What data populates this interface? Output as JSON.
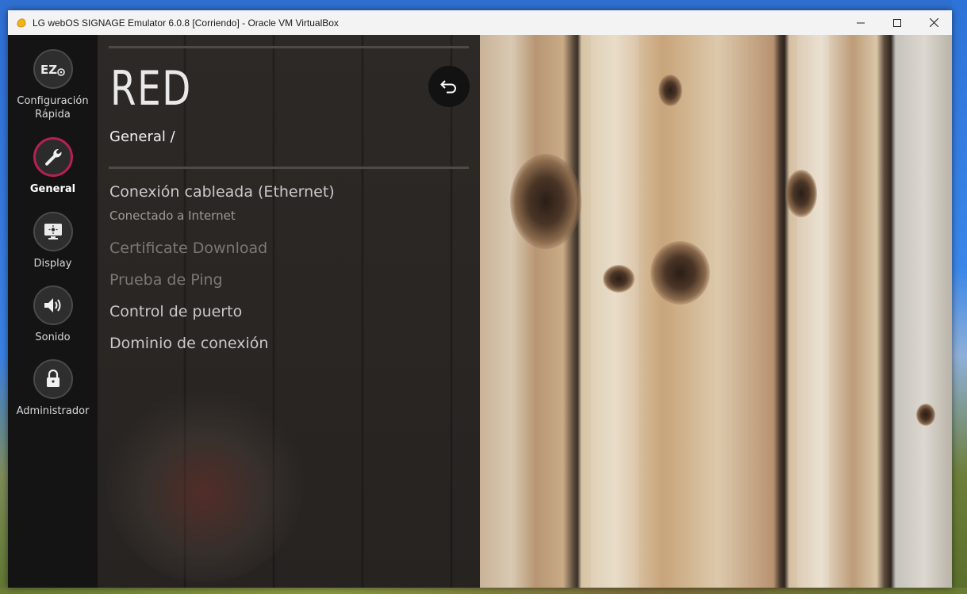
{
  "window": {
    "title": "LG webOS SIGNAGE Emulator 6.0.8 [Corriendo] - Oracle VM VirtualBox",
    "controls": [
      "minimize-icon",
      "maximize-icon",
      "close-icon"
    ]
  },
  "nav": {
    "items": [
      {
        "label": "Configuración Rápida",
        "icon": "ez-settings-icon",
        "active": false
      },
      {
        "label": "General",
        "icon": "wrench-icon",
        "active": true
      },
      {
        "label": "Display",
        "icon": "display-icon",
        "active": false
      },
      {
        "label": "Sonido",
        "icon": "speaker-icon",
        "active": false
      },
      {
        "label": "Administrador",
        "icon": "lock-icon",
        "active": false
      }
    ]
  },
  "panel": {
    "title": "RED",
    "breadcrumb": "General /",
    "back_icon": "back-arrow-icon",
    "menu": [
      {
        "label": "Conexión cableada (Ethernet)",
        "sub": "Conectado a Internet",
        "enabled": true
      },
      {
        "label": "Certificate Download",
        "enabled": false
      },
      {
        "label": "Prueba de Ping",
        "enabled": false
      },
      {
        "label": "Control de puerto",
        "enabled": true
      },
      {
        "label": "Dominio de conexión",
        "enabled": true
      }
    ]
  },
  "colors": {
    "accent": "#b5204f",
    "nav_bg": "#141414",
    "titlebar_bg": "#f3f3f3"
  }
}
